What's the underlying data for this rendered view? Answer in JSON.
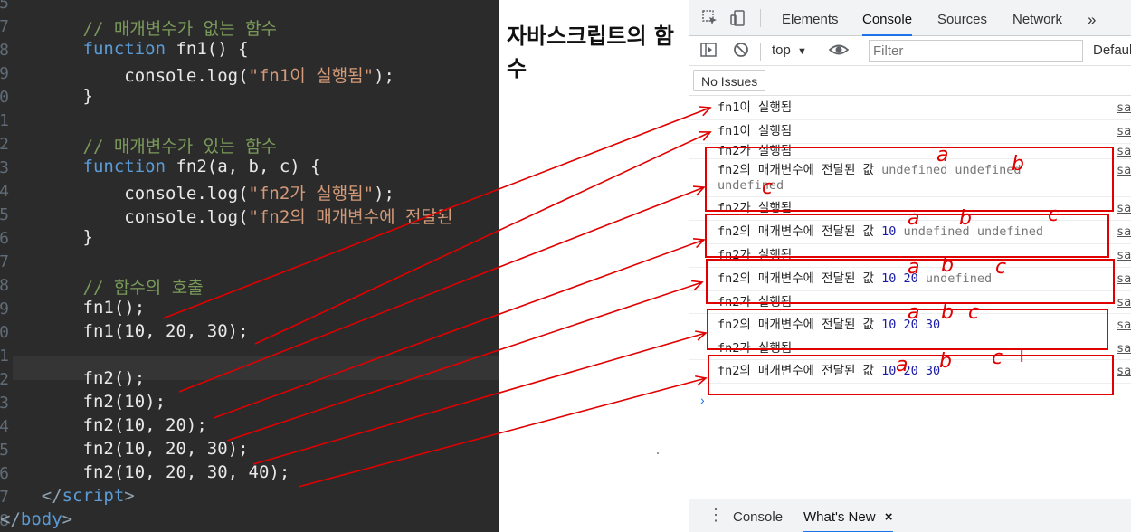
{
  "editor": {
    "line_numbers": [
      "5",
      "7",
      "8",
      "9",
      "0",
      "1",
      "2",
      "3",
      "4",
      "5",
      "6",
      "7",
      "8",
      "9",
      "0",
      "1",
      "2",
      "3",
      "4",
      "5",
      "6",
      "7",
      "8"
    ],
    "lines": [
      [],
      [
        {
          "t": "        // 매개변수가 없는 함수",
          "c": "comment"
        }
      ],
      [
        {
          "t": "        ",
          "c": "plain"
        },
        {
          "t": "function",
          "c": "kw"
        },
        {
          "t": " fn1() {",
          "c": "plain"
        }
      ],
      [
        {
          "t": "            console.log(",
          "c": "plain"
        },
        {
          "t": "\"fn1이 실행됨\"",
          "c": "str"
        },
        {
          "t": ");",
          "c": "plain"
        }
      ],
      [
        {
          "t": "        }",
          "c": "plain"
        }
      ],
      [],
      [
        {
          "t": "        // 매개변수가 있는 함수",
          "c": "comment"
        }
      ],
      [
        {
          "t": "        ",
          "c": "plain"
        },
        {
          "t": "function",
          "c": "kw"
        },
        {
          "t": " fn2(a, b, c) {",
          "c": "plain"
        }
      ],
      [
        {
          "t": "            console.log(",
          "c": "plain"
        },
        {
          "t": "\"fn2가 실행됨\"",
          "c": "str"
        },
        {
          "t": ");",
          "c": "plain"
        }
      ],
      [
        {
          "t": "            console.log(",
          "c": "plain"
        },
        {
          "t": "\"fn2의 매개변수에 전달된",
          "c": "str"
        }
      ],
      [
        {
          "t": "        }",
          "c": "plain"
        }
      ],
      [],
      [
        {
          "t": "        // 함수의 호출",
          "c": "comment"
        }
      ],
      [
        {
          "t": "        fn1();",
          "c": "plain"
        }
      ],
      [
        {
          "t": "        fn1(10, 20, 30);",
          "c": "plain"
        }
      ],
      [],
      [
        {
          "t": "        fn2();",
          "c": "plain"
        }
      ],
      [
        {
          "t": "        fn2(10);",
          "c": "plain"
        }
      ],
      [
        {
          "t": "        fn2(10, 20);",
          "c": "plain"
        }
      ],
      [
        {
          "t": "        fn2(10, 20, 30);",
          "c": "plain"
        }
      ],
      [
        {
          "t": "        fn2(10, 20, 30, 40);",
          "c": "plain"
        }
      ],
      [
        {
          "t": "    </",
          "c": "tag"
        },
        {
          "t": "script",
          "c": "tagname"
        },
        {
          "t": ">",
          "c": "tag"
        }
      ],
      [
        {
          "t": "</",
          "c": "tag"
        },
        {
          "t": "body",
          "c": "tagname"
        },
        {
          "t": ">",
          "c": "tag"
        }
      ]
    ]
  },
  "page": {
    "title": "자바스크립트의 함수"
  },
  "devtools": {
    "tabs": [
      "Elements",
      "Console",
      "Sources",
      "Network"
    ],
    "active_tab": "Console",
    "more_tabs": "»",
    "context": "top",
    "filter_placeholder": "Filter",
    "levels": "Defaul",
    "issues_button": "No Issues",
    "source_link": "sar",
    "prompt": "›",
    "drawer_tabs": [
      "Console",
      "What's New"
    ],
    "drawer_close": "×",
    "messages": [
      {
        "text": "fn1이 실행됨"
      },
      {
        "text": "fn1이 실행됨"
      },
      {
        "text": "fn2가 실행됨"
      },
      {
        "text": "fn2의 매개변수에 전달된 값",
        "args": [
          {
            "v": "undefined",
            "k": "undef"
          },
          {
            "v": "undefined",
            "k": "undef"
          },
          {
            "v": "undefined",
            "k": "undef"
          }
        ]
      },
      {
        "text": "fn2가 실행됨"
      },
      {
        "text": "fn2의 매개변수에 전달된 값",
        "args": [
          {
            "v": "10",
            "k": "num"
          },
          {
            "v": "undefined",
            "k": "undef"
          },
          {
            "v": "undefined",
            "k": "undef"
          }
        ]
      },
      {
        "text": "fn2가 실행됨"
      },
      {
        "text": "fn2의 매개변수에 전달된 값",
        "args": [
          {
            "v": "10",
            "k": "num"
          },
          {
            "v": "20",
            "k": "num"
          },
          {
            "v": "undefined",
            "k": "undef"
          }
        ]
      },
      {
        "text": "fn2가 실행됨"
      },
      {
        "text": "fn2의 매개변수에 전달된 값",
        "args": [
          {
            "v": "10",
            "k": "num"
          },
          {
            "v": "20",
            "k": "num"
          },
          {
            "v": "30",
            "k": "num"
          }
        ]
      },
      {
        "text": "fn2가 실행됨"
      },
      {
        "text": "fn2의 매개변수에 전달된 값",
        "args": [
          {
            "v": "10",
            "k": "num"
          },
          {
            "v": "20",
            "k": "num"
          },
          {
            "v": "30",
            "k": "num"
          }
        ]
      }
    ]
  },
  "annotations": {
    "color": "#e00000",
    "labels": [
      "a",
      "b",
      "c",
      "a",
      "b",
      "c",
      "a",
      "b",
      "c",
      "a",
      "b",
      "c",
      "a",
      "b",
      "c",
      "+"
    ]
  }
}
